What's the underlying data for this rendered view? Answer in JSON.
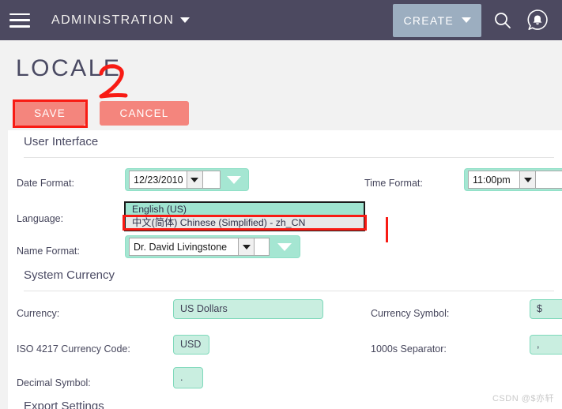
{
  "topbar": {
    "menu_icon": "hamburger-menu-icon",
    "title": "ADMINISTRATION",
    "caret_icon": "chevron-down-icon",
    "create_label": "CREATE",
    "create_caret_icon": "chevron-down-icon",
    "search_icon": "search-icon",
    "notification_icon": "bell-notification-icon"
  },
  "page": {
    "title": "LOCALE",
    "save_label": "SAVE",
    "cancel_label": "CANCEL"
  },
  "sections": {
    "user_interface": {
      "heading": "User Interface",
      "date_format_label": "Date Format:",
      "date_format_value": "12/23/2010",
      "time_format_label": "Time Format:",
      "time_format_value": "11:00pm",
      "language_label": "Language:",
      "language_options": [
        "English (US)",
        "中文(简体) Chinese (Simplified) - zh_CN"
      ],
      "name_format_label": "Name Format:",
      "name_format_value": "Dr. David Livingstone"
    },
    "system_currency": {
      "heading": "System Currency",
      "currency_label": "Currency:",
      "currency_value": "US Dollars",
      "currency_symbol_label": "Currency Symbol:",
      "currency_symbol_value": "$",
      "iso_code_label": "ISO 4217 Currency Code:",
      "iso_code_value": "USD",
      "thousands_label": "1000s Separator:",
      "thousands_value": ",",
      "decimal_label": "Decimal Symbol:",
      "decimal_value": "."
    },
    "export_settings": {
      "heading": "Export Settings"
    }
  },
  "annotations": {
    "step_number": "2"
  },
  "watermark": "CSDN @$亦轩",
  "colors": {
    "navbar": "#4c4960",
    "create_button": "#9caec0",
    "action_button": "#f4857d",
    "input_fill": "#c9eee0",
    "input_border": "#7fd9bb",
    "select_fill": "#a5e6d2",
    "annotation_red": "#f81b14",
    "text_dark": "#46465c",
    "page_bg": "#f2f2f2"
  }
}
